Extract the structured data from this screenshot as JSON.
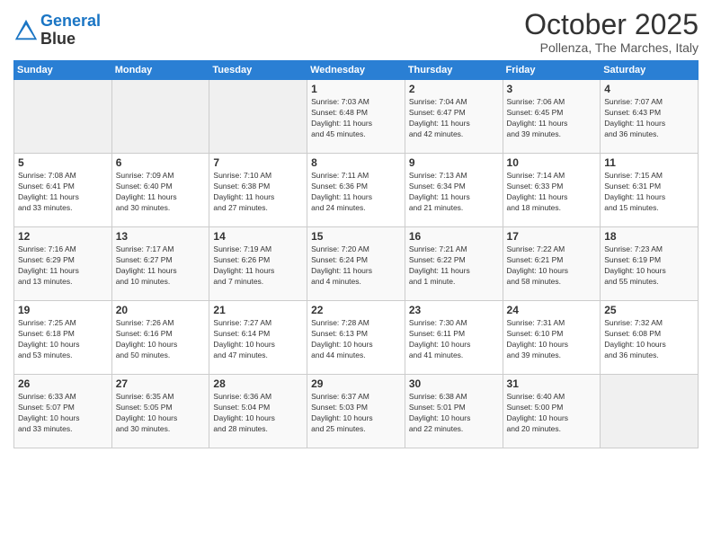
{
  "header": {
    "logo_line1": "General",
    "logo_line2": "Blue",
    "month": "October 2025",
    "location": "Pollenza, The Marches, Italy"
  },
  "days_of_week": [
    "Sunday",
    "Monday",
    "Tuesday",
    "Wednesday",
    "Thursday",
    "Friday",
    "Saturday"
  ],
  "weeks": [
    [
      {
        "day": "",
        "info": ""
      },
      {
        "day": "",
        "info": ""
      },
      {
        "day": "",
        "info": ""
      },
      {
        "day": "1",
        "info": "Sunrise: 7:03 AM\nSunset: 6:48 PM\nDaylight: 11 hours\nand 45 minutes."
      },
      {
        "day": "2",
        "info": "Sunrise: 7:04 AM\nSunset: 6:47 PM\nDaylight: 11 hours\nand 42 minutes."
      },
      {
        "day": "3",
        "info": "Sunrise: 7:06 AM\nSunset: 6:45 PM\nDaylight: 11 hours\nand 39 minutes."
      },
      {
        "day": "4",
        "info": "Sunrise: 7:07 AM\nSunset: 6:43 PM\nDaylight: 11 hours\nand 36 minutes."
      }
    ],
    [
      {
        "day": "5",
        "info": "Sunrise: 7:08 AM\nSunset: 6:41 PM\nDaylight: 11 hours\nand 33 minutes."
      },
      {
        "day": "6",
        "info": "Sunrise: 7:09 AM\nSunset: 6:40 PM\nDaylight: 11 hours\nand 30 minutes."
      },
      {
        "day": "7",
        "info": "Sunrise: 7:10 AM\nSunset: 6:38 PM\nDaylight: 11 hours\nand 27 minutes."
      },
      {
        "day": "8",
        "info": "Sunrise: 7:11 AM\nSunset: 6:36 PM\nDaylight: 11 hours\nand 24 minutes."
      },
      {
        "day": "9",
        "info": "Sunrise: 7:13 AM\nSunset: 6:34 PM\nDaylight: 11 hours\nand 21 minutes."
      },
      {
        "day": "10",
        "info": "Sunrise: 7:14 AM\nSunset: 6:33 PM\nDaylight: 11 hours\nand 18 minutes."
      },
      {
        "day": "11",
        "info": "Sunrise: 7:15 AM\nSunset: 6:31 PM\nDaylight: 11 hours\nand 15 minutes."
      }
    ],
    [
      {
        "day": "12",
        "info": "Sunrise: 7:16 AM\nSunset: 6:29 PM\nDaylight: 11 hours\nand 13 minutes."
      },
      {
        "day": "13",
        "info": "Sunrise: 7:17 AM\nSunset: 6:27 PM\nDaylight: 11 hours\nand 10 minutes."
      },
      {
        "day": "14",
        "info": "Sunrise: 7:19 AM\nSunset: 6:26 PM\nDaylight: 11 hours\nand 7 minutes."
      },
      {
        "day": "15",
        "info": "Sunrise: 7:20 AM\nSunset: 6:24 PM\nDaylight: 11 hours\nand 4 minutes."
      },
      {
        "day": "16",
        "info": "Sunrise: 7:21 AM\nSunset: 6:22 PM\nDaylight: 11 hours\nand 1 minute."
      },
      {
        "day": "17",
        "info": "Sunrise: 7:22 AM\nSunset: 6:21 PM\nDaylight: 10 hours\nand 58 minutes."
      },
      {
        "day": "18",
        "info": "Sunrise: 7:23 AM\nSunset: 6:19 PM\nDaylight: 10 hours\nand 55 minutes."
      }
    ],
    [
      {
        "day": "19",
        "info": "Sunrise: 7:25 AM\nSunset: 6:18 PM\nDaylight: 10 hours\nand 53 minutes."
      },
      {
        "day": "20",
        "info": "Sunrise: 7:26 AM\nSunset: 6:16 PM\nDaylight: 10 hours\nand 50 minutes."
      },
      {
        "day": "21",
        "info": "Sunrise: 7:27 AM\nSunset: 6:14 PM\nDaylight: 10 hours\nand 47 minutes."
      },
      {
        "day": "22",
        "info": "Sunrise: 7:28 AM\nSunset: 6:13 PM\nDaylight: 10 hours\nand 44 minutes."
      },
      {
        "day": "23",
        "info": "Sunrise: 7:30 AM\nSunset: 6:11 PM\nDaylight: 10 hours\nand 41 minutes."
      },
      {
        "day": "24",
        "info": "Sunrise: 7:31 AM\nSunset: 6:10 PM\nDaylight: 10 hours\nand 39 minutes."
      },
      {
        "day": "25",
        "info": "Sunrise: 7:32 AM\nSunset: 6:08 PM\nDaylight: 10 hours\nand 36 minutes."
      }
    ],
    [
      {
        "day": "26",
        "info": "Sunrise: 6:33 AM\nSunset: 5:07 PM\nDaylight: 10 hours\nand 33 minutes."
      },
      {
        "day": "27",
        "info": "Sunrise: 6:35 AM\nSunset: 5:05 PM\nDaylight: 10 hours\nand 30 minutes."
      },
      {
        "day": "28",
        "info": "Sunrise: 6:36 AM\nSunset: 5:04 PM\nDaylight: 10 hours\nand 28 minutes."
      },
      {
        "day": "29",
        "info": "Sunrise: 6:37 AM\nSunset: 5:03 PM\nDaylight: 10 hours\nand 25 minutes."
      },
      {
        "day": "30",
        "info": "Sunrise: 6:38 AM\nSunset: 5:01 PM\nDaylight: 10 hours\nand 22 minutes."
      },
      {
        "day": "31",
        "info": "Sunrise: 6:40 AM\nSunset: 5:00 PM\nDaylight: 10 hours\nand 20 minutes."
      },
      {
        "day": "",
        "info": ""
      }
    ]
  ]
}
